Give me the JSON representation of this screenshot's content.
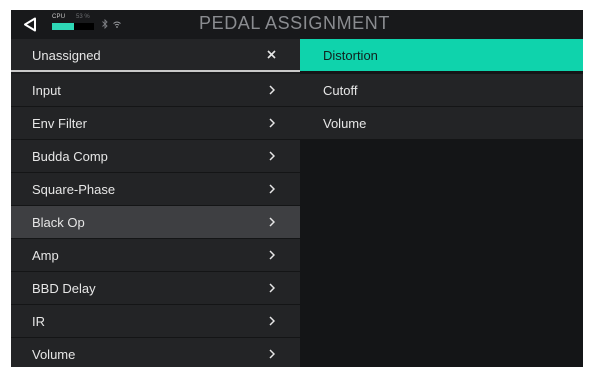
{
  "header": {
    "title": "PEDAL ASSIGNMENT",
    "cpu_label": "CPU",
    "cpu_percent": "53 %",
    "cpu_fraction": 0.53,
    "accent_color": "#0fd3ac"
  },
  "left_list": {
    "items": [
      {
        "label": "Unassigned",
        "action_icon": "close-icon"
      },
      {
        "label": "Input",
        "action_icon": "chevron-right-icon"
      },
      {
        "label": "Env Filter",
        "action_icon": "chevron-right-icon"
      },
      {
        "label": "Budda Comp",
        "action_icon": "chevron-right-icon"
      },
      {
        "label": "Square-Phase",
        "action_icon": "chevron-right-icon"
      },
      {
        "label": "Black Op",
        "action_icon": "chevron-right-icon",
        "selected": true
      },
      {
        "label": "Amp",
        "action_icon": "chevron-right-icon"
      },
      {
        "label": "BBD Delay",
        "action_icon": "chevron-right-icon"
      },
      {
        "label": "IR",
        "action_icon": "chevron-right-icon"
      },
      {
        "label": "Volume",
        "action_icon": "chevron-right-icon"
      }
    ]
  },
  "right_list": {
    "items": [
      {
        "label": "Distortion",
        "active": true
      },
      {
        "label": "Cutoff"
      },
      {
        "label": "Volume"
      }
    ]
  }
}
